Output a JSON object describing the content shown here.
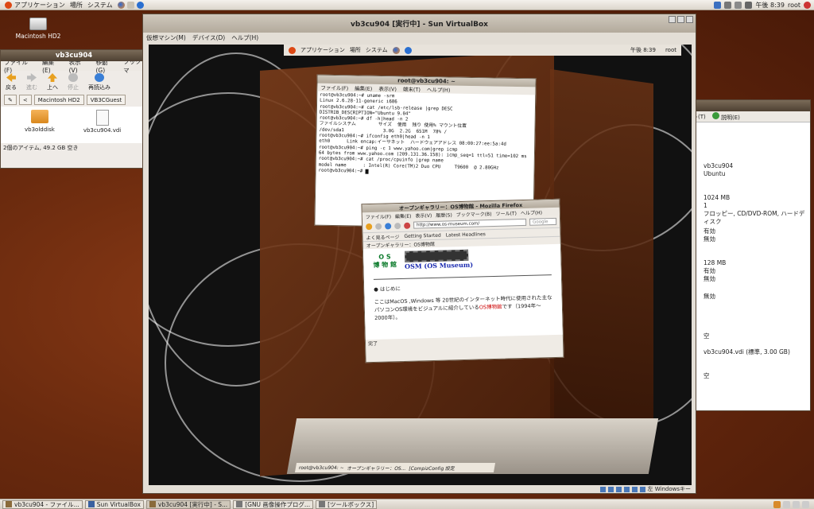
{
  "top_panel": {
    "menu_apps": "アプリケーション",
    "menu_places": "場所",
    "menu_system": "システム",
    "clock": "午後 8:39",
    "user": "root"
  },
  "desktop": {
    "hdd_label": "Macintosh HD2"
  },
  "nautilus": {
    "title": "vb3cu904",
    "menu": [
      "ファイル(F)",
      "編集(E)",
      "表示(V)",
      "移動(G)",
      "ブックマ"
    ],
    "toolbar": [
      "戻る",
      "進む",
      "上へ",
      "停止",
      "再読込み"
    ],
    "path": [
      "Macintosh HD2",
      "VB3CGuest"
    ],
    "files": [
      "vb3olddisk",
      "vb3cu904.vdi"
    ],
    "status": "2個のアイテム, 49.2 GB 空き"
  },
  "vbox": {
    "title": "vb3cu904 [実行中] - Sun VirtualBox",
    "menu": [
      "仮想マシン(M)",
      "デバイス(D)",
      "ヘルプ(H)"
    ],
    "host_key": "左 Windowsキー"
  },
  "guest": {
    "panel_apps": "アプリケーション",
    "panel_places": "場所",
    "panel_system": "システム",
    "panel_clock": "午後 8:39",
    "panel_user": "root",
    "terminal": {
      "title": "root@vb3cu904: ~",
      "menu": [
        "ファイル(F)",
        "編集(E)",
        "表示(V)",
        "端末(T)",
        "ヘルプ(H)"
      ],
      "lines": [
        "root@vb3cu904:~# uname -srm",
        "Linux 2.6.28-11-generic i686",
        "root@vb3cu904:~# cat /etc/lsb-release |grep DESC",
        "DISTRIB_DESCRIPTION=\"Ubuntu 9.04\"",
        "root@vb3cu904:~# df -h|head -n 2",
        "ファイルシステム        サイズ  使用  残り 使用% マウント位置",
        "/dev/sda1              3.0G  2.2G  651M  78% /",
        "root@vb3cu904:~# ifconfig eth0|head -n 1",
        "eth0      Link encap:イーサネット  ハードウェアアドレス 08:00:27:ee:5a:4d",
        "root@vb3cu904:~# ping -c 1 www.yahoo.com|grep icmp",
        "64 bytes from www.yahoo.com (209.131.36.158): icmp_seq=1 ttl=51 time=102 ms",
        "root@vb3cu904:~# cat /proc/cpuinfo |grep name",
        "model name      : Intel(R) Core(TM)2 Duo CPU     T9600  @ 2.80GHz",
        "root@vb3cu904:~# "
      ]
    },
    "firefox": {
      "title": "オープンギャラリー：OS博物館 - Mozilla Firefox",
      "menu": [
        "ファイル(F)",
        "編集(E)",
        "表示(V)",
        "履歴(S)",
        "ブックマーク(B)",
        "ツール(T)",
        "ヘルプ(H)"
      ],
      "url": "http://www.os-museum.com/",
      "search_placeholder": "Google",
      "bookmarks": [
        "よく見るページ",
        "Getting Started",
        "Latest Headlines"
      ],
      "tab": "オープンギャラリー：OS博物館",
      "logo_top": "O S",
      "logo_bottom": "博 物 館",
      "site_title": "OSM (OS Museum)",
      "heading": "はじめに",
      "body_text": "ここはMacOS ,Windows 等 20世紀のインターネット時代に使用された主なパソコンOS環境をビジュアルに紹介している",
      "body_link": "OS博物館",
      "body_tail": "です（1994年〜2000年）。",
      "status": "完了"
    },
    "taskbar": [
      "root@vb3cu904: ~",
      "オープンギャラリー：OS...",
      "[CompizConfig 設定"
    ]
  },
  "details": {
    "tabs": [
      "ト(T)",
      "説明(E)"
    ],
    "values": [
      "vb3cu904",
      "Ubuntu",
      "1024 MB",
      "1",
      "フロッピー, CD/DVD-ROM, ハードディスク",
      "有効",
      "無効",
      "128 MB",
      "有効",
      "無効",
      "無効",
      "空",
      "vb3cu904.vdi (標準, 3.00 GB)",
      "空"
    ]
  },
  "taskbar": [
    "vb3cu904 - ファイル...",
    "Sun VirtualBox",
    "vb3cu904 [実行中] - S...",
    "[GNU 画像操作プログ...",
    "[ツールボックス]"
  ]
}
